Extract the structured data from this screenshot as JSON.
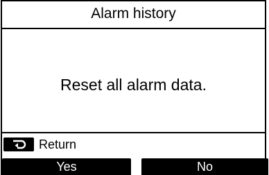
{
  "screen": {
    "title": "Alarm history",
    "message": "Reset all alarm data.",
    "return_label": "Return",
    "return_key_icon": "return-arrow-icon",
    "buttons": {
      "yes": "Yes",
      "no": "No"
    }
  },
  "colors": {
    "background": "#ffffff",
    "foreground": "#000000",
    "button_text": "#ffffff"
  }
}
